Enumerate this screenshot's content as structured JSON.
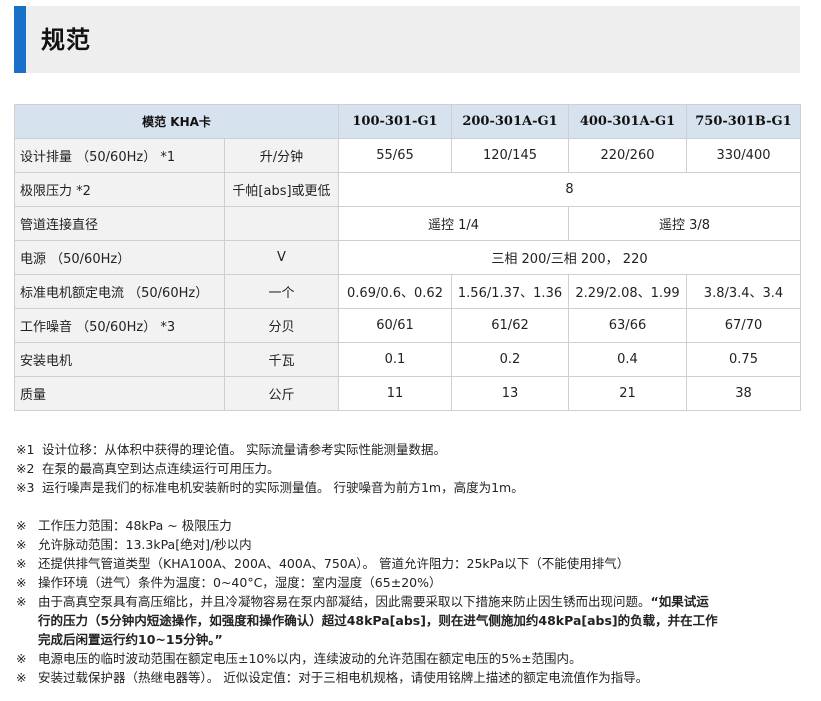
{
  "section": {
    "title": "规范"
  },
  "table": {
    "header": {
      "model_label": "模范 KHA卡",
      "models": [
        "100-301-G1",
        "200-301A-G1",
        "400-301A-G1",
        "750-301B-G1"
      ]
    },
    "rows": {
      "displacement": {
        "label": "设计排量 （50/60Hz） *1",
        "unit": "升/分钟",
        "values": [
          "55/65",
          "120/145",
          "220/260",
          "330/400"
        ]
      },
      "ultimate_pressure": {
        "label": "极限压力 *2",
        "unit": "千帕[abs]或更低",
        "value": "8"
      },
      "pipe_connection": {
        "label": "管道连接直径",
        "unit": "",
        "values": [
          "遥控 1/4",
          "遥控 3/8"
        ]
      },
      "power_supply": {
        "label": "电源 （50/60Hz）",
        "unit": "V",
        "value": "三相 200/三相 200， 220"
      },
      "rated_current": {
        "label": "标准电机额定电流 （50/60Hz）",
        "unit": "一个",
        "values": [
          "0.69/0.6、0.62",
          "1.56/1.37、1.36",
          "2.29/2.08、1.99",
          "3.8/3.4、3.4"
        ]
      },
      "noise": {
        "label": "工作噪音 （50/60Hz） *3",
        "unit": "分贝",
        "values": [
          "60/61",
          "61/62",
          "63/66",
          "67/70"
        ]
      },
      "motor": {
        "label": "安装电机",
        "unit": "千瓦",
        "values": [
          "0.1",
          "0.2",
          "0.4",
          "0.75"
        ]
      },
      "mass": {
        "label": "质量",
        "unit": "公斤",
        "values": [
          "11",
          "13",
          "21",
          "38"
        ]
      }
    }
  },
  "footnotes": [
    {
      "mark": "※1",
      "text": "设计位移：从体积中获得的理论值。 实际流量请参考实际性能测量数据。"
    },
    {
      "mark": "※2",
      "text": "在泵的最高真空到达点连续运行可用压力。"
    },
    {
      "mark": "※3",
      "text": "运行噪声是我们的标准电机安装新时的实际测量值。 行驶噪音为前方1m，高度为1m。"
    }
  ],
  "notes": [
    {
      "mark": "※",
      "text": "工作压力范围：48kPa ~ 极限压力"
    },
    {
      "mark": "※",
      "text": "允许脉动范围：13.3kPa[绝对]/秒以内"
    },
    {
      "mark": "※",
      "text": "还提供排气管道类型（KHA100A、200A、400A、750A）。 管道允许阻力：25kPa以下（不能使用排气）"
    },
    {
      "mark": "※",
      "text": "操作环境（进气）条件为温度：0~40°C，湿度：室内湿度（65±20%）"
    },
    {
      "mark": "※",
      "text": "由于高真空泵具有高压缩比，并且冷凝物容易在泵内部凝结，因此需要采取以下措施来防止因生锈而出现问题。",
      "strong_1": "“如果试运",
      "strong_2": "行的压力（5分钟内短途操作，如强度和操作确认）超过48kPa[abs]，则在进气侧施加约48kPa[abs]的负载，并在工作",
      "strong_3": "完成后闲置运行约10~15分钟。”"
    },
    {
      "mark": "※",
      "text": "电源电压的临时波动范围在额定电压±10%以内，连续波动的允许范围在额定电压的5%±范围内。"
    },
    {
      "mark": "※",
      "text": "安装过载保护器（热继电器等）。 近似设定值：对于三相电机规格，请使用铭牌上描述的额定电流值作为指导。"
    }
  ],
  "colors": {
    "accent": "#1a6fc9",
    "header_bg": "#d6e3ef",
    "label_bg": "#f2f2f2",
    "heading_bg": "#eeeeee"
  }
}
